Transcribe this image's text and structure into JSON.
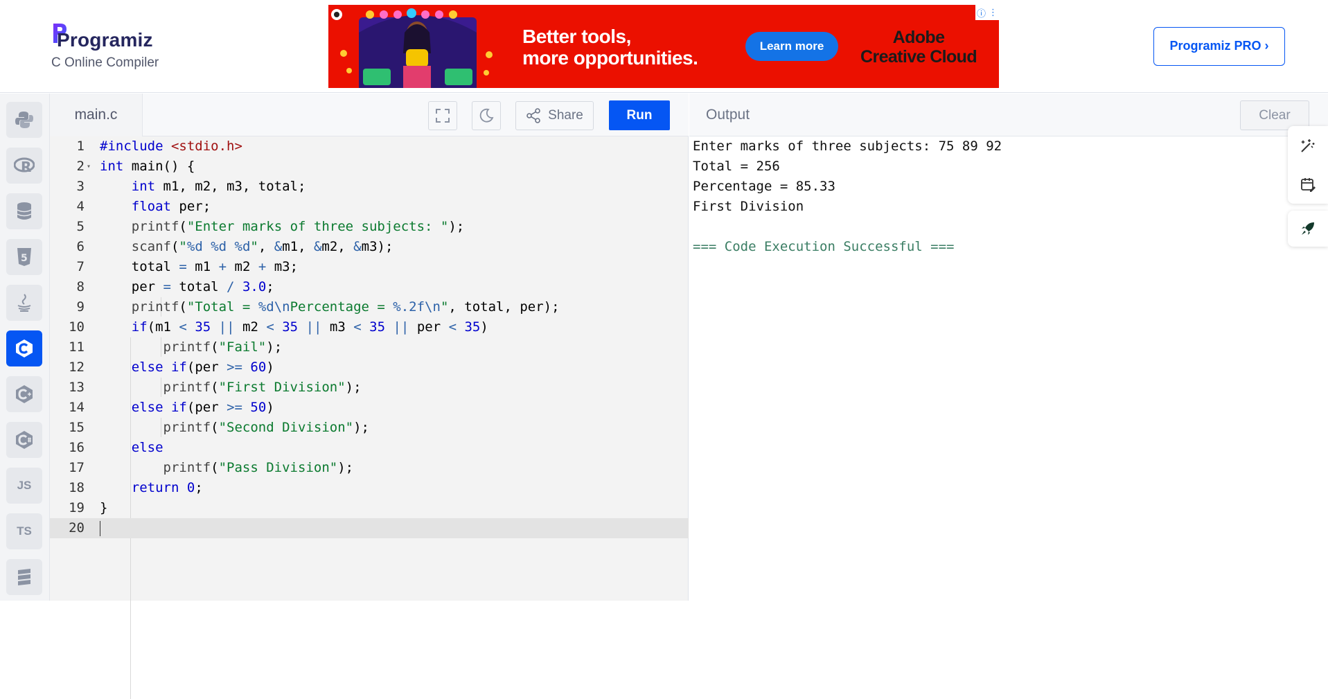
{
  "header": {
    "brand": "Programiz",
    "subtitle": "C Online Compiler",
    "ad": {
      "headline": "Better tools,\nmore opportunities.",
      "cta": "Learn more",
      "brand": "Adobe\nCreative Cloud",
      "info_icon": "info-icon",
      "menu_icon": "more-vertical-icon"
    },
    "pro_button": "Programiz PRO ›"
  },
  "sidebar": {
    "items": [
      {
        "name": "python",
        "label": "",
        "icon": "python-icon"
      },
      {
        "name": "r",
        "label": "",
        "icon": "r-icon"
      },
      {
        "name": "sql",
        "label": "",
        "icon": "database-icon"
      },
      {
        "name": "html",
        "label": "",
        "icon": "html5-icon"
      },
      {
        "name": "java",
        "label": "",
        "icon": "java-icon"
      },
      {
        "name": "c",
        "label": "",
        "icon": "c-icon",
        "active": true
      },
      {
        "name": "cpp",
        "label": "",
        "icon": "cpp-icon"
      },
      {
        "name": "csharp",
        "label": "",
        "icon": "csharp-icon"
      },
      {
        "name": "javascript",
        "label": "JS",
        "icon": ""
      },
      {
        "name": "typescript",
        "label": "TS",
        "icon": ""
      },
      {
        "name": "more",
        "label": "",
        "icon": "stack-icon"
      }
    ]
  },
  "editor": {
    "filename": "main.c",
    "share_label": "Share",
    "run_label": "Run",
    "current_line": 20,
    "lines": [
      "#include <stdio.h>",
      "int main() {",
      "    int m1, m2, m3, total;",
      "    float per;",
      "    printf(\"Enter marks of three subjects: \");",
      "    scanf(\"%d %d %d\", &m1, &m2, &m3);",
      "    total = m1 + m2 + m3;",
      "    per = total / 3.0;",
      "    printf(\"Total = %d\\nPercentage = %.2f\\n\", total, per);",
      "    if(m1 < 35 || m2 < 35 || m3 < 35 || per < 35)",
      "        printf(\"Fail\");",
      "    else if(per >= 60)",
      "        printf(\"First Division\");",
      "    else if(per >= 50)",
      "        printf(\"Second Division\");",
      "    else",
      "        printf(\"Pass Division\");",
      "    return 0;",
      "}",
      ""
    ]
  },
  "output": {
    "title": "Output",
    "clear_label": "Clear",
    "lines": [
      "Enter marks of three subjects: 75 89 92",
      "Total = 256",
      "Percentage = 85.33",
      "First Division",
      "",
      "=== Code Execution Successful ==="
    ]
  },
  "colors": {
    "accent": "#0556f3",
    "ad_background": "#eb1000",
    "success_text": "#3a7d63"
  }
}
